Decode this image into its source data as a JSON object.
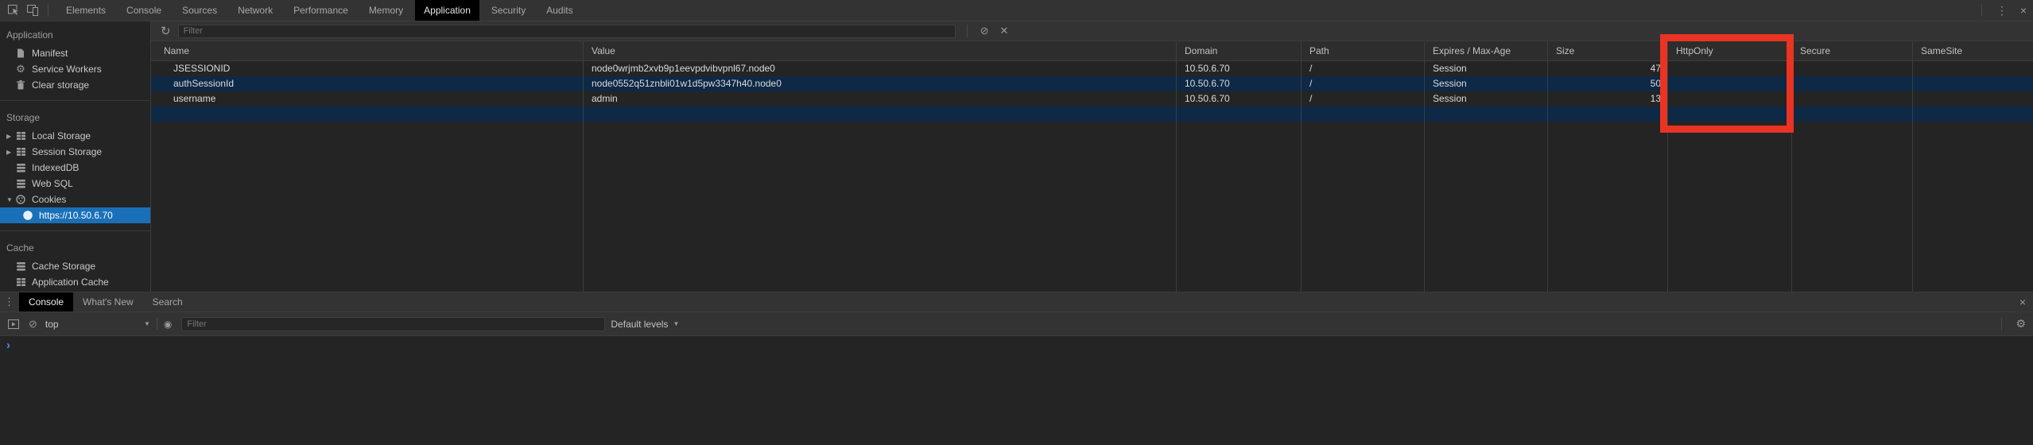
{
  "colors": {
    "selection_blue": "#1a70b8",
    "row_stripe_blue": "#0e2946",
    "annotation_red": "#ea3323",
    "prompt_blue": "#4a88f2",
    "selected_tab_bg": "#000000",
    "toolbar_bg": "#333333",
    "panel_bg": "#242424"
  },
  "top_bar": {
    "tabs": [
      "Elements",
      "Console",
      "Sources",
      "Network",
      "Performance",
      "Memory",
      "Application",
      "Security",
      "Audits"
    ],
    "selected_tab": "Application",
    "more_glyph": "⋮",
    "close_glyph": "×"
  },
  "sidebar": {
    "sections": [
      {
        "title": "Application",
        "items": [
          {
            "label": "Manifest"
          },
          {
            "label": "Service Workers"
          },
          {
            "label": "Clear storage"
          }
        ]
      },
      {
        "title": "Storage",
        "items": [
          {
            "label": "Local Storage"
          },
          {
            "label": "Session Storage"
          },
          {
            "label": "IndexedDB"
          },
          {
            "label": "Web SQL"
          },
          {
            "label": "Cookies"
          },
          {
            "label": "https://10.50.6.70"
          }
        ]
      },
      {
        "title": "Cache",
        "items": [
          {
            "label": "Cache Storage"
          },
          {
            "label": "Application Cache"
          }
        ]
      }
    ],
    "selected_item": "https://10.50.6.70",
    "expander_collapsed": "▶",
    "expander_expanded": "▼"
  },
  "cookies_pane": {
    "refresh_glyph": "↻",
    "filter_placeholder": "Filter",
    "clear_all_glyph": "⊘",
    "delete_glyph": "✕",
    "table": {
      "columns": [
        "Name",
        "Value",
        "Domain",
        "Path",
        "Expires / Max-Age",
        "Size",
        "HttpOnly",
        "Secure",
        "SameSite"
      ],
      "rows": [
        {
          "name": "JSESSIONID",
          "value": "node0wrjmb2xvb9p1eevpdvibvpnl67.node0",
          "domain": "10.50.6.70",
          "path": "/",
          "expires": "Session",
          "size": "47",
          "httponly": "",
          "secure": "",
          "samesite": ""
        },
        {
          "name": "authSessionId",
          "value": "node0552q51znbli01w1d5pw3347h40.node0",
          "domain": "10.50.6.70",
          "path": "/",
          "expires": "Session",
          "size": "50",
          "httponly": "",
          "secure": "",
          "samesite": ""
        },
        {
          "name": "username",
          "value": "admin",
          "domain": "10.50.6.70",
          "path": "/",
          "expires": "Session",
          "size": "13",
          "httponly": "",
          "secure": "",
          "samesite": ""
        }
      ]
    },
    "annotation": {
      "highlighted_column": "HttpOnly"
    }
  },
  "console_drawer": {
    "more_glyph": "⋮",
    "tabs": [
      "Console",
      "What's New",
      "Search"
    ],
    "selected_tab": "Console",
    "close_glyph": "×",
    "toolbar": {
      "clear_glyph": "⊘",
      "context_selector": "top",
      "dropdown_arrow": "▼",
      "eye_glyph": "◉",
      "filter_placeholder": "Filter",
      "levels_label": "Default levels",
      "settings_glyph": "⚙"
    },
    "prompt_glyph": "›"
  }
}
